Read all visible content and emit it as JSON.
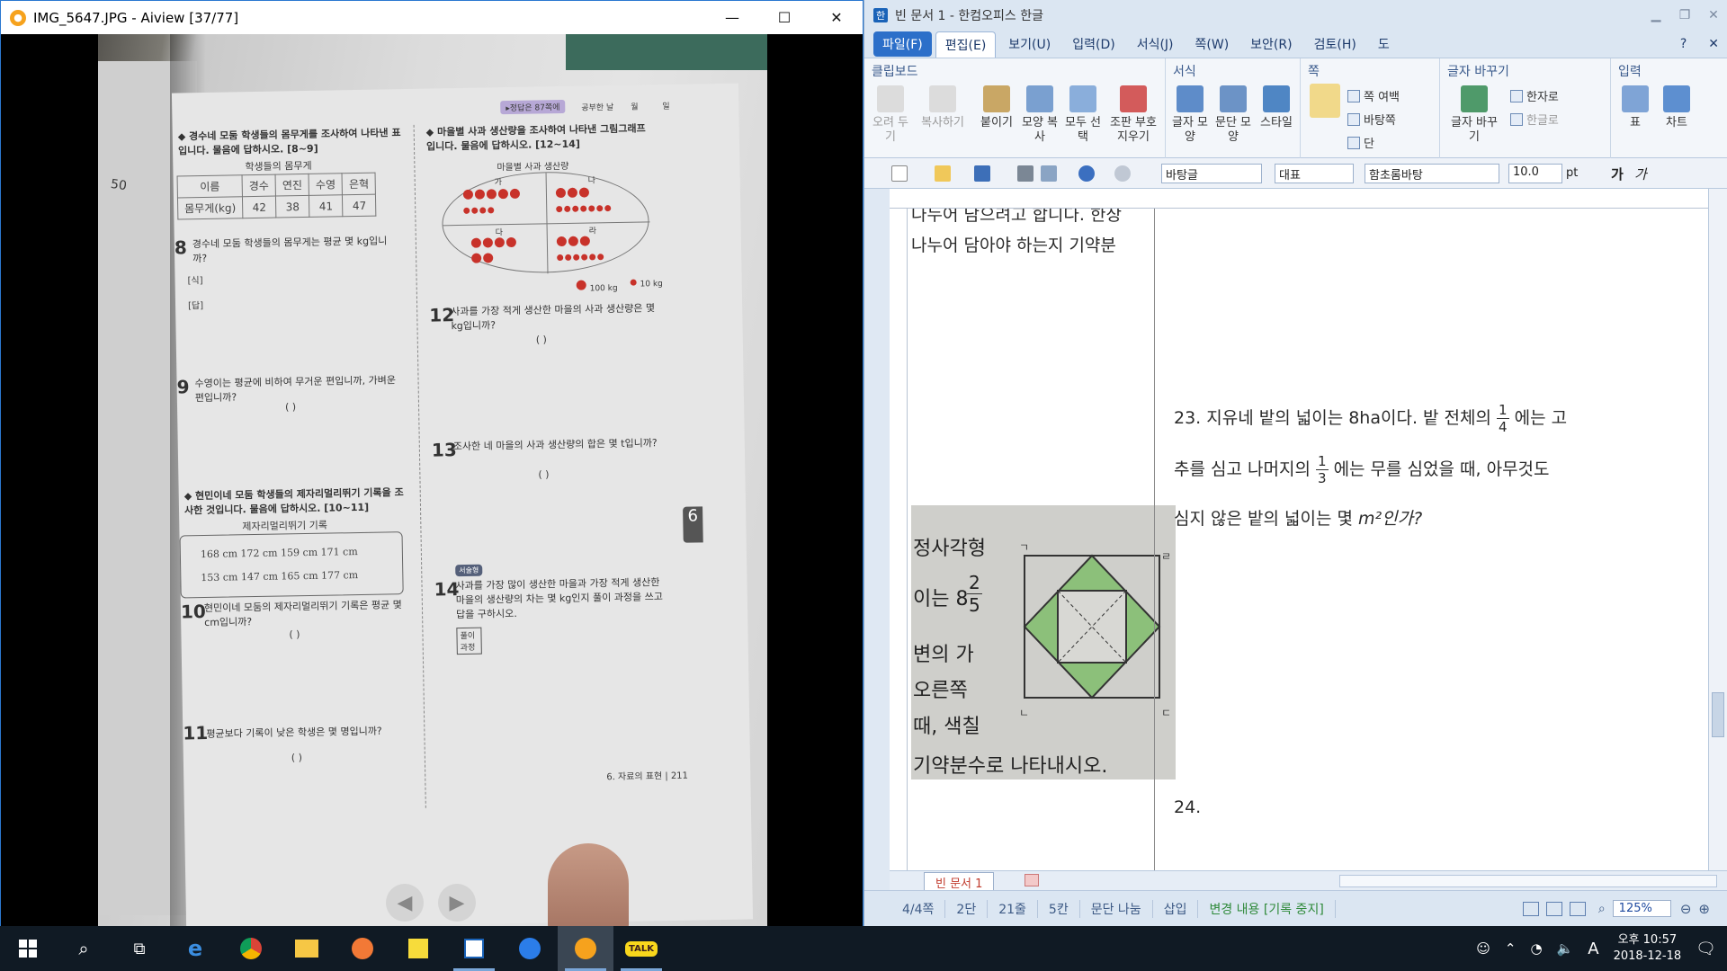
{
  "viewer": {
    "title": "IMG_5647.JPG - Aiview [37/77]",
    "window_controls": {
      "minimize": "—",
      "maximize": "☐",
      "close": "✕"
    },
    "photo": {
      "header_badge": "▸정답은 87쪽에",
      "header_labels": [
        "공부한 날",
        "월",
        "일"
      ],
      "q8_9_intro": "◆ 경수네 모둠 학생들의 몸무게를 조사하여 나타낸 표입니다. 물음에 답하시오. [8~9]",
      "table_title": "학생들의 몸무게",
      "table_header": [
        "이름",
        "경수",
        "연진",
        "수영",
        "은혁"
      ],
      "table_row": [
        "몸무게(kg)",
        "42",
        "38",
        "41",
        "47"
      ],
      "q8_num": "8",
      "q8": "경수네 모둠 학생들의 몸무게는 평균 몇 kg입니까?",
      "q8_sik": "[식]",
      "q8_dap": "[답]",
      "q9_num": "9",
      "q9": "수영이는 평균에 비하여 무거운 편입니까, 가벼운 편입니까?",
      "paren": "(          )",
      "q10_11_intro": "◆ 현민이네 모둠 학생들의 제자리멀리뛰기 기록을 조사한 것입니다. 물음에 답하시오. [10~11]",
      "record_title": "제자리멀리뛰기 기록",
      "records_row1": "168 cm   172 cm   159 cm   171 cm",
      "records_row2": "153 cm   147 cm   165 cm   177 cm",
      "q10_num": "10",
      "q10": "현민이네 모둠의 제자리멀리뛰기 기록은 평균 몇 cm입니까?",
      "q11_num": "11",
      "q11": "평균보다 기록이 낮은 학생은 몇 명입니까?",
      "q12_14_intro": "◆ 마을별 사과 생산량을 조사하여 나타낸 그림그래프입니다. 물음에 답하시오. [12~14]",
      "graph_title": "마을별 사과 생산량",
      "villages": [
        "가",
        "나",
        "다",
        "라"
      ],
      "legend": [
        "100 kg",
        "10 kg"
      ],
      "q12_num": "12",
      "q12": "사과를 가장 적게 생산한 마을의 사과 생산량은 몇 kg입니까?",
      "q13_num": "13",
      "q13": "조사한 네 마을의 사과 생산량의 합은 몇 t입니까?",
      "q14_num": "14",
      "q14_tag": "서술형",
      "q14": "사과를 가장 많이 생산한 마을과 가장 적게 생산한 마을의 생산량의 차는 몇 kg인지 풀이 과정을 쓰고 답을 구하시오.",
      "q14_box": "풀이 과정",
      "page_footer": "6. 자료의 표현 | 211",
      "side_tab": "6",
      "left_page_number": "50"
    }
  },
  "hwp": {
    "title": "빈 문서 1 - 한컴오피스 한글",
    "menus": [
      "파일(F)",
      "편집(E)",
      "보기(U)",
      "입력(D)",
      "서식(J)",
      "쪽(W)",
      "보안(R)",
      "검토(H)",
      "도"
    ],
    "ribbon": {
      "groups": [
        "클립보드",
        "서식",
        "쪽",
        "글자 바꾸기",
        "입력"
      ],
      "clipboard": [
        "오려 두기",
        "복사하기",
        "붙이기",
        "모양 복사",
        "모두 선택",
        "조판 부호 지우기"
      ],
      "format": [
        "글자 모양",
        "문단 모양",
        "스타일"
      ],
      "page": [
        "쪽 여백",
        "바탕쪽",
        "단"
      ],
      "charconv": [
        "한자로",
        "한글로",
        "글자 바꾸기"
      ],
      "insert": [
        "표",
        "차트"
      ]
    },
    "toolbar": {
      "style": "바탕글",
      "lang": "대표",
      "font": "함초롬바탕",
      "size": "10.0",
      "size_unit": "pt",
      "bold": "가",
      "italic": "가"
    },
    "doc": {
      "left_line1": "나누어 담으려고 합니다. 한상",
      "left_line2": "나누어  담아야  하는지  기약분",
      "problem23_a": "23.  지유네  밭의  넓이는  8ha이다.  밭  전체의",
      "problem23_frac1": [
        "1",
        "4"
      ],
      "problem23_b": "에는  고",
      "problem23_c": "추를  심고  나머지의",
      "problem23_frac2": [
        "1",
        "3"
      ],
      "problem23_d": "에는  무를  심었을  때,  아무것도",
      "problem23_e": "심지  않은  밭의  넓이는  몇",
      "problem23_unit": "m²인가?",
      "problem24": "24.",
      "scan_lines": [
        "정사각형",
        "이는 8",
        "변의 가",
        "오른쪽",
        "때, 색칠",
        "기약분수로 나타내시오."
      ],
      "scan_frac": [
        "2",
        "5"
      ],
      "scan_letters": [
        "ㄱ",
        "ㄹ",
        "ㄴ",
        "ㄷ"
      ]
    },
    "doc_tab": "빈 문서 1",
    "status": [
      "4/4쪽",
      "2단",
      "21줄",
      "5칸",
      "문단 나눔",
      "삽입",
      "변경 내용 [기록 중지]"
    ],
    "zoom": "125%"
  },
  "taskbar": {
    "clock_time": "오후 10:57",
    "clock_date": "2018-12-18",
    "ime": "A",
    "talk": "TALK"
  },
  "colors": {
    "hwp_accent": "#2c6fc9",
    "taskbar_bg": "#101a24",
    "viewer_border": "#2b78d0"
  }
}
